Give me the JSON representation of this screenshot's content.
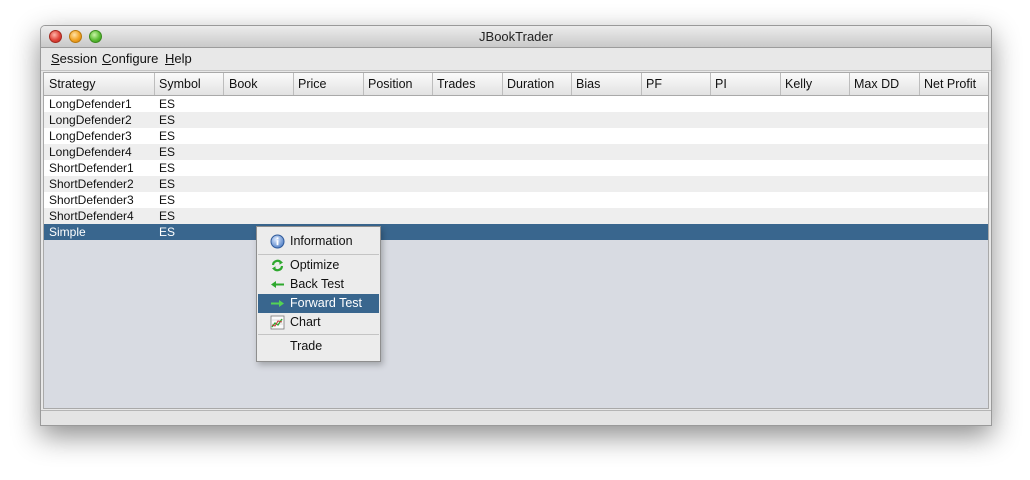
{
  "window": {
    "title": "JBookTrader"
  },
  "menubar": {
    "items": [
      {
        "label": "Session",
        "mnemonic": "S",
        "rest": "ession"
      },
      {
        "label": "Configure",
        "mnemonic": "C",
        "rest": "onfigure"
      },
      {
        "label": "Help",
        "mnemonic": "H",
        "rest": "elp"
      }
    ]
  },
  "table": {
    "columns": [
      "Strategy",
      "Symbol",
      "Book",
      "Price",
      "Position",
      "Trades",
      "Duration",
      "Bias",
      "PF",
      "PI",
      "Kelly",
      "Max DD",
      "Net Profit"
    ],
    "rows": [
      [
        "LongDefender1",
        "ES"
      ],
      [
        "LongDefender2",
        "ES"
      ],
      [
        "LongDefender3",
        "ES"
      ],
      [
        "LongDefender4",
        "ES"
      ],
      [
        "ShortDefender1",
        "ES"
      ],
      [
        "ShortDefender2",
        "ES"
      ],
      [
        "ShortDefender3",
        "ES"
      ],
      [
        "ShortDefender4",
        "ES"
      ],
      [
        "Simple",
        "ES"
      ]
    ],
    "selected_row": "Simple"
  },
  "context_menu": {
    "items": [
      {
        "label": "Information",
        "icon": "info-icon"
      },
      {
        "label": "Optimize",
        "icon": "optimize-icon"
      },
      {
        "label": "Back Test",
        "icon": "arrow-left-icon"
      },
      {
        "label": "Forward Test",
        "icon": "arrow-right-icon",
        "highlighted": true
      },
      {
        "label": "Chart",
        "icon": "chart-icon"
      },
      {
        "label": "Trade",
        "icon": ""
      }
    ]
  },
  "colors": {
    "selection": "#39668e",
    "accent_green": "#2ea82e"
  }
}
